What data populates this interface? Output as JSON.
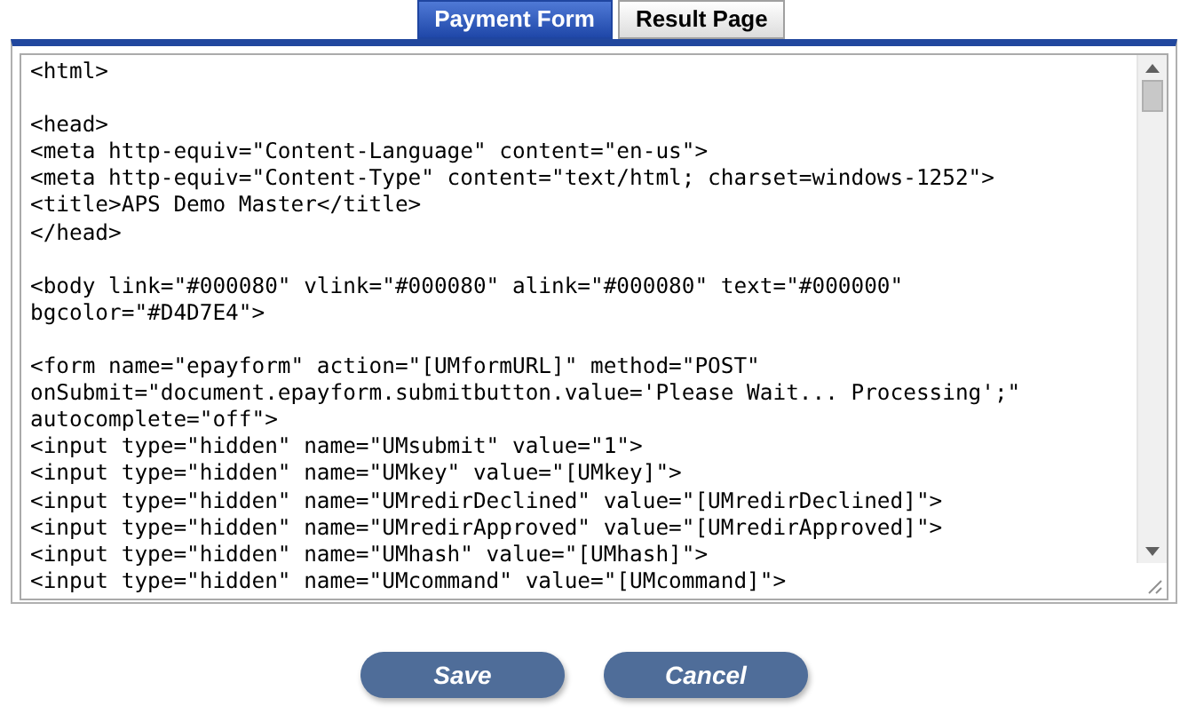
{
  "tabs": [
    {
      "label": "Payment Form",
      "selected": true
    },
    {
      "label": "Result Page",
      "selected": false
    }
  ],
  "editor": {
    "blocks": [
      [
        "<html>"
      ],
      [
        "<head>",
        "<meta http-equiv=\"Content-Language\" content=\"en-us\">",
        "<meta http-equiv=\"Content-Type\" content=\"text/html; charset=windows-1252\">",
        "<title>APS Demo Master</title>",
        "</head>"
      ],
      [
        "<body link=\"#000080\" vlink=\"#000080\" alink=\"#000080\" text=\"#000000\"",
        "bgcolor=\"#D4D7E4\">"
      ],
      [
        "<form name=\"epayform\" action=\"[UMformURL]\" method=\"POST\"",
        "onSubmit=\"document.epayform.submitbutton.value='Please Wait... Processing';\"",
        "autocomplete=\"off\">",
        "<input type=\"hidden\" name=\"UMsubmit\" value=\"1\">",
        "<input type=\"hidden\" name=\"UMkey\" value=\"[UMkey]\">",
        "<input type=\"hidden\" name=\"UMredirDeclined\" value=\"[UMredirDeclined]\">",
        "<input type=\"hidden\" name=\"UMredirApproved\" value=\"[UMredirApproved]\">",
        "<input type=\"hidden\" name=\"UMhash\" value=\"[UMhash]\">",
        "<input type=\"hidden\" name=\"UMcommand\" value=\"[UMcommand]\">"
      ]
    ]
  },
  "buttons": [
    "Save",
    "Cancel"
  ]
}
